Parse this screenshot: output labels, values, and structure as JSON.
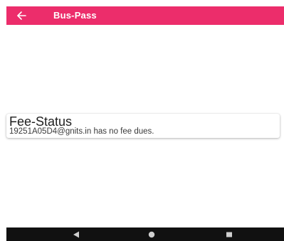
{
  "app_bar": {
    "title": "Bus-Pass",
    "back_icon": "arrow-left-icon",
    "color": "#ec2d6b"
  },
  "fee_status": {
    "title": "Fee-Status",
    "message": "19251A05D4@gnits.in has no fee dues."
  },
  "nav_bar": {
    "back_icon": "triangle-back-icon",
    "home_icon": "circle-home-icon",
    "recents_icon": "square-recents-icon",
    "color": "#111111"
  }
}
